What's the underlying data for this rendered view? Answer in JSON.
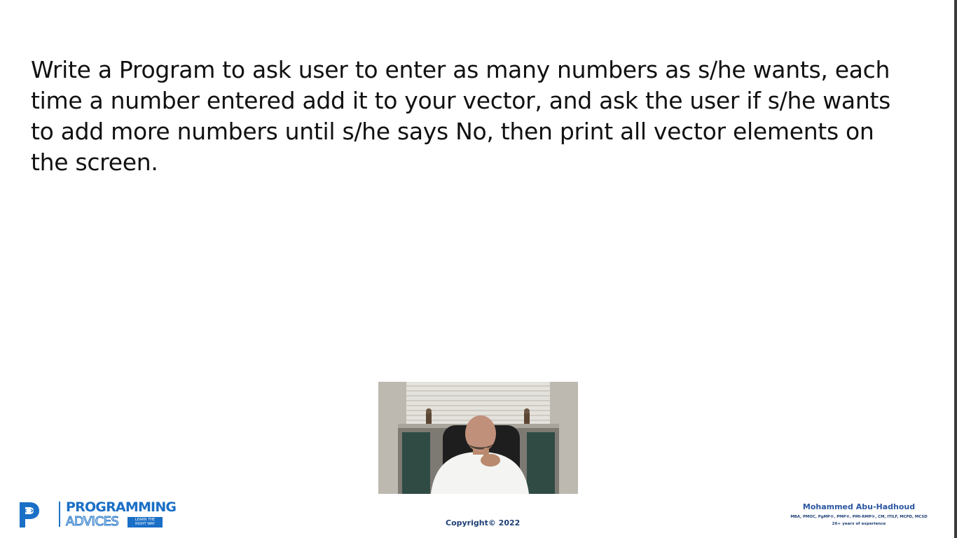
{
  "slide": {
    "question_lines": [
      "Write a Program to ask user to enter as many numbers as s/he wants, each",
      "time a number entered add it to your vector, and ask the user if s/he wants",
      "to add more numbers until s/he says No, then print all vector elements on",
      "the screen."
    ]
  },
  "branding": {
    "logo_line1": "PROGRAMMING",
    "logo_line2": "ADVICES",
    "logo_tag_line1": "LEARN THE",
    "logo_tag_line2": "RIGHT WAY",
    "brand_color": "#1a6fc6"
  },
  "footer": {
    "copyright": "Copyright© 2022",
    "author_name": "Mohammed Abu-Hadhoud",
    "author_certs": "MBA, PMOC, PgMP®, PMP®, PMI-RMP®, CM, ITILF, MCPD, MCSD",
    "author_experience": "26+ years of experience",
    "text_color": "#1e3f75"
  }
}
